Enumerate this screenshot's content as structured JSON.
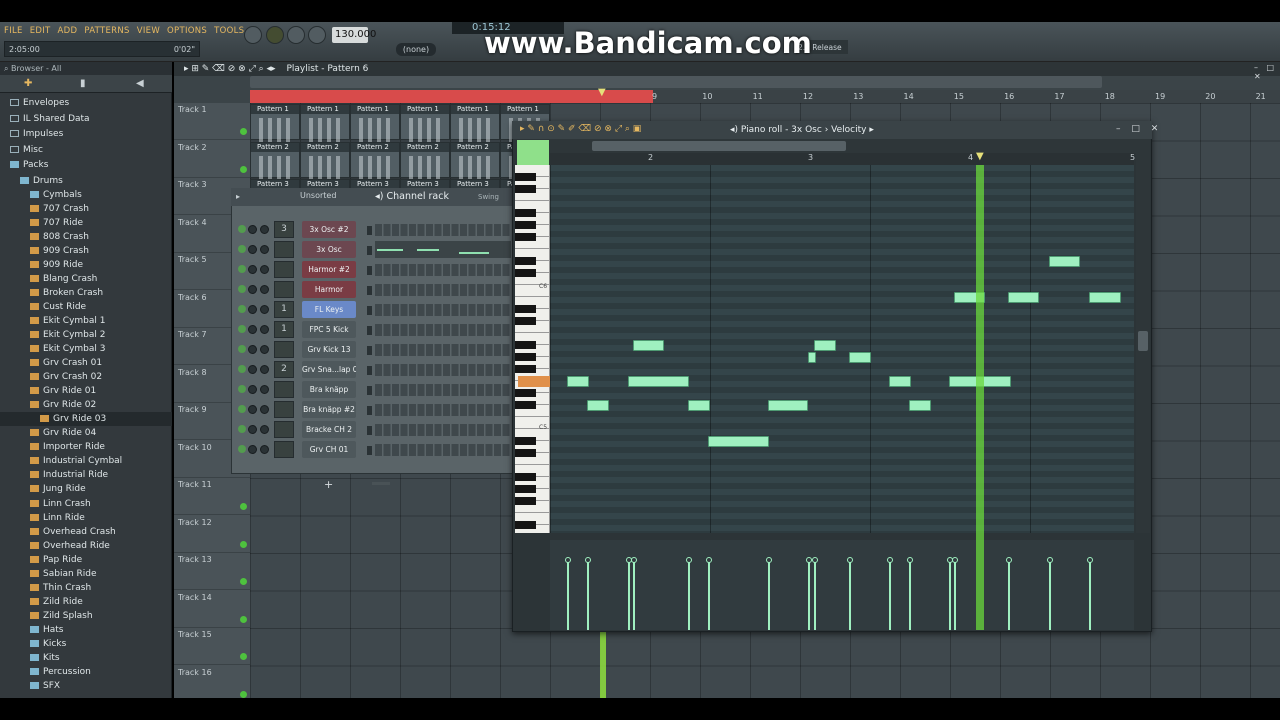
{
  "menu": [
    "FILE",
    "EDIT",
    "ADD",
    "PATTERNS",
    "VIEW",
    "OPTIONS",
    "TOOLS",
    "?"
  ],
  "hint": {
    "position": "2:05:00",
    "time": "0'02\""
  },
  "tempo": "130.000",
  "clock": "0:15:12",
  "pattern_selector": "(none)",
  "watermark": "www.Bandicam.com",
  "release_label": "2.1 Release",
  "browser": {
    "header": "Browser - All",
    "items": [
      {
        "label": "Envelopes",
        "type": "folder",
        "indent": 0
      },
      {
        "label": "IL Shared Data",
        "type": "folder",
        "indent": 0
      },
      {
        "label": "Impulses",
        "type": "folder",
        "indent": 0
      },
      {
        "label": "Misc",
        "type": "folder",
        "indent": 0
      },
      {
        "label": "Packs",
        "type": "open",
        "indent": 0
      },
      {
        "label": "Drums",
        "type": "open",
        "indent": 1
      },
      {
        "label": "Cymbals",
        "type": "open",
        "indent": 2
      },
      {
        "label": "707 Crash",
        "type": "wave",
        "indent": 2
      },
      {
        "label": "707 Ride",
        "type": "wave",
        "indent": 2
      },
      {
        "label": "808 Crash",
        "type": "wave",
        "indent": 2
      },
      {
        "label": "909 Crash",
        "type": "wave",
        "indent": 2
      },
      {
        "label": "909 Ride",
        "type": "wave",
        "indent": 2
      },
      {
        "label": "Blang Crash",
        "type": "wave",
        "indent": 2
      },
      {
        "label": "Broken Crash",
        "type": "wave",
        "indent": 2
      },
      {
        "label": "Cust Ride",
        "type": "wave",
        "indent": 2
      },
      {
        "label": "Ekit Cymbal 1",
        "type": "wave",
        "indent": 2
      },
      {
        "label": "Ekit Cymbal 2",
        "type": "wave",
        "indent": 2
      },
      {
        "label": "Ekit Cymbal 3",
        "type": "wave",
        "indent": 2
      },
      {
        "label": "Grv Crash 01",
        "type": "wave",
        "indent": 2
      },
      {
        "label": "Grv Crash 02",
        "type": "wave",
        "indent": 2
      },
      {
        "label": "Grv Ride 01",
        "type": "wave",
        "indent": 2
      },
      {
        "label": "Grv Ride 02",
        "type": "wave",
        "indent": 2
      },
      {
        "label": "Grv Ride 03",
        "type": "wave",
        "indent": 3
      },
      {
        "label": "Grv Ride 04",
        "type": "wave",
        "indent": 2
      },
      {
        "label": "Importer Ride",
        "type": "wave",
        "indent": 2
      },
      {
        "label": "Industrial Cymbal",
        "type": "wave",
        "indent": 2
      },
      {
        "label": "Industrial Ride",
        "type": "wave",
        "indent": 2
      },
      {
        "label": "Jung Ride",
        "type": "wave",
        "indent": 2
      },
      {
        "label": "Linn Crash",
        "type": "wave",
        "indent": 2
      },
      {
        "label": "Linn Ride",
        "type": "wave",
        "indent": 2
      },
      {
        "label": "Overhead Crash",
        "type": "wave",
        "indent": 2
      },
      {
        "label": "Overhead Ride",
        "type": "wave",
        "indent": 2
      },
      {
        "label": "Pap Ride",
        "type": "wave",
        "indent": 2
      },
      {
        "label": "Sabian Ride",
        "type": "wave",
        "indent": 2
      },
      {
        "label": "Thin Crash",
        "type": "wave",
        "indent": 2
      },
      {
        "label": "Zild Ride",
        "type": "wave",
        "indent": 2
      },
      {
        "label": "Zild Splash",
        "type": "wave",
        "indent": 2
      },
      {
        "label": "Hats",
        "type": "open",
        "indent": 2
      },
      {
        "label": "Kicks",
        "type": "open",
        "indent": 2
      },
      {
        "label": "Kits",
        "type": "open",
        "indent": 2
      },
      {
        "label": "Percussion",
        "type": "open",
        "indent": 2
      },
      {
        "label": "SFX",
        "type": "open",
        "indent": 2
      }
    ]
  },
  "playlist": {
    "title": "Playlist - Pattern 6",
    "bar_numbers": [
      "9",
      "10",
      "11",
      "12",
      "13",
      "14",
      "15",
      "16",
      "17",
      "18",
      "19",
      "20",
      "21"
    ],
    "tracks": [
      "Track 1",
      "Track 2",
      "Track 3",
      "Track 4",
      "Track 5",
      "Track 6",
      "Track 7",
      "Track 8",
      "Track 9",
      "Track 10",
      "Track 11",
      "Track 12",
      "Track 13",
      "Track 14",
      "Track 15",
      "Track 16"
    ],
    "clips": [
      {
        "label": "Pattern 1",
        "track": 0
      },
      {
        "label": "Pattern 2",
        "track": 1
      },
      {
        "label": "Pattern 3",
        "track": 2
      }
    ]
  },
  "channel_rack": {
    "title": "Channel rack",
    "filter": "Unsorted",
    "swing_label": "Swing",
    "add_label": "+",
    "channels": [
      {
        "num": "3",
        "name": "3x Osc #2",
        "color": "#6c4750"
      },
      {
        "num": "",
        "name": "3x Osc",
        "color": "#6c4750"
      },
      {
        "num": "",
        "name": "Harmor #2",
        "color": "#7a3c44"
      },
      {
        "num": "",
        "name": "Harmor",
        "color": "#7a3c44"
      },
      {
        "num": "1",
        "name": "FL Keys",
        "color": "#6a89c8"
      },
      {
        "num": "1",
        "name": "FPC 5 Kick",
        "color": "#4e585c"
      },
      {
        "num": "",
        "name": "Grv Kick 13",
        "color": "#4e585c"
      },
      {
        "num": "2",
        "name": "Grv Sna...lap 08",
        "color": "#4e585c"
      },
      {
        "num": "",
        "name": "Bra knäpp",
        "color": "#4e585c"
      },
      {
        "num": "",
        "name": "Bra knäpp #2",
        "color": "#4e585c"
      },
      {
        "num": "",
        "name": "Bracke CH 2",
        "color": "#4e585c"
      },
      {
        "num": "",
        "name": "Grv CH 01",
        "color": "#4e585c"
      }
    ]
  },
  "piano_roll": {
    "title": "Piano roll - 3x Osc",
    "target": "Velocity",
    "bar_numbers": [
      "2",
      "3",
      "4",
      "5"
    ],
    "key_labels": [
      "C6",
      "C5"
    ]
  }
}
